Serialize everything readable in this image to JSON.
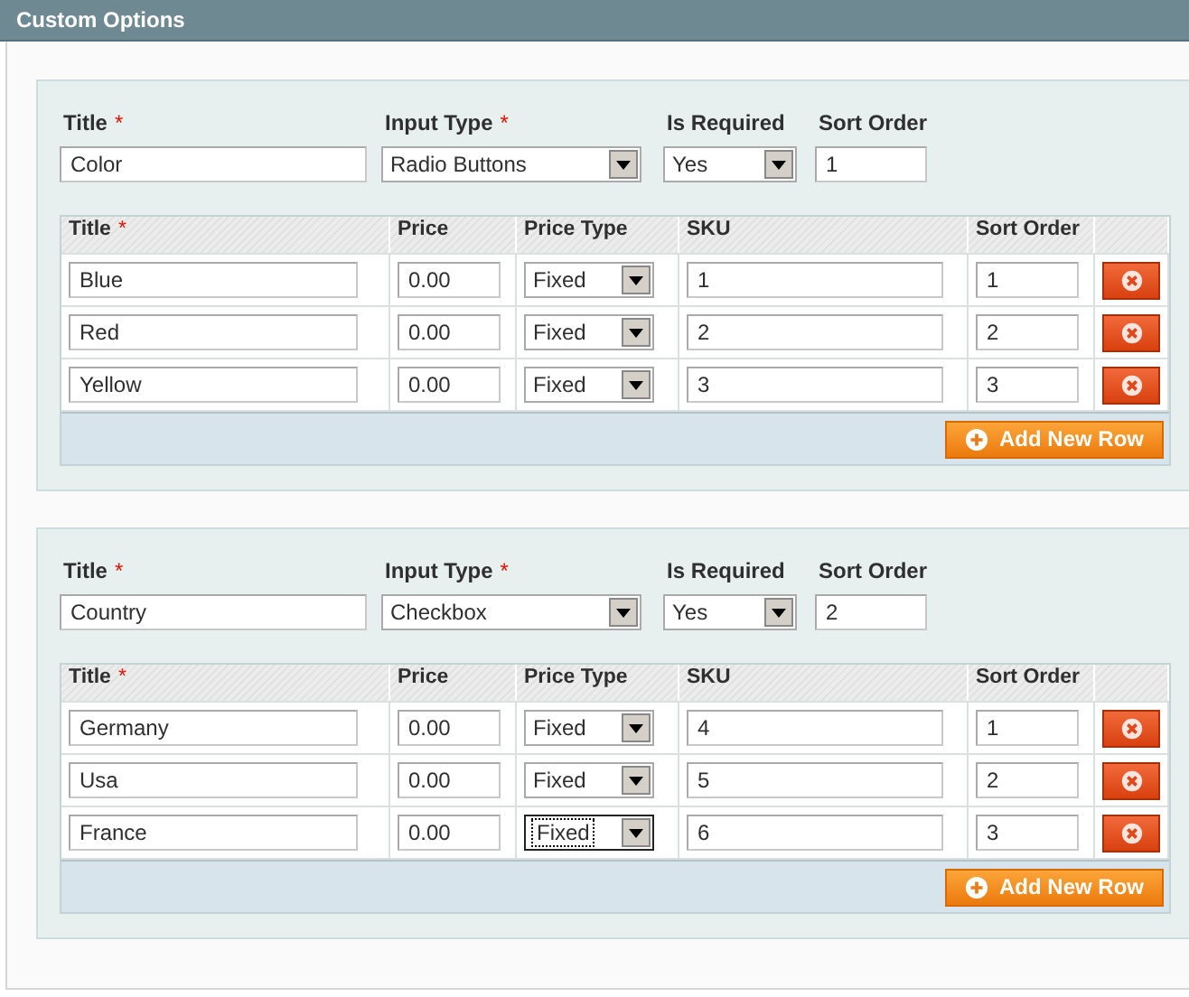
{
  "header": {
    "title": "Custom Options"
  },
  "options": [
    {
      "fields": [
        {
          "kind": "text",
          "label": "Title",
          "required_mark": "*",
          "value": "Color"
        },
        {
          "kind": "select",
          "label": "Input Type",
          "required_mark": "*",
          "value": "Radio Buttons"
        },
        {
          "kind": "select",
          "label": "Is Required",
          "value": "Yes"
        },
        {
          "kind": "text",
          "label": "Sort Order",
          "value": "1"
        }
      ],
      "columns": [
        {
          "label": "Title",
          "required_mark": "*"
        },
        {
          "label": "Price"
        },
        {
          "label": "Price Type"
        },
        {
          "label": "SKU"
        },
        {
          "label": "Sort Order"
        }
      ],
      "rows": [
        {
          "title": "Blue",
          "price": "0.00",
          "price_type": "Fixed",
          "focused": false,
          "sku": "1",
          "sort_order": "1"
        },
        {
          "title": "Red",
          "price": "0.00",
          "price_type": "Fixed",
          "focused": false,
          "sku": "2",
          "sort_order": "2"
        },
        {
          "title": "Yellow",
          "price": "0.00",
          "price_type": "Fixed",
          "focused": false,
          "sku": "3",
          "sort_order": "3"
        }
      ],
      "add_button": "Add New Row"
    },
    {
      "fields": [
        {
          "kind": "text",
          "label": "Title",
          "required_mark": "*",
          "value": "Country"
        },
        {
          "kind": "select",
          "label": "Input Type",
          "required_mark": "*",
          "value": "Checkbox"
        },
        {
          "kind": "select",
          "label": "Is Required",
          "value": "Yes"
        },
        {
          "kind": "text",
          "label": "Sort Order",
          "value": "2"
        }
      ],
      "columns": [
        {
          "label": "Title",
          "required_mark": "*"
        },
        {
          "label": "Price"
        },
        {
          "label": "Price Type"
        },
        {
          "label": "SKU"
        },
        {
          "label": "Sort Order"
        }
      ],
      "rows": [
        {
          "title": "Germany",
          "price": "0.00",
          "price_type": "Fixed",
          "focused": false,
          "sku": "4",
          "sort_order": "1"
        },
        {
          "title": "Usa",
          "price": "0.00",
          "price_type": "Fixed",
          "focused": false,
          "sku": "5",
          "sort_order": "2"
        },
        {
          "title": "France",
          "price": "0.00",
          "price_type": "Fixed",
          "focused": true,
          "sku": "6",
          "sort_order": "3"
        }
      ],
      "add_button": "Add New Row"
    }
  ]
}
